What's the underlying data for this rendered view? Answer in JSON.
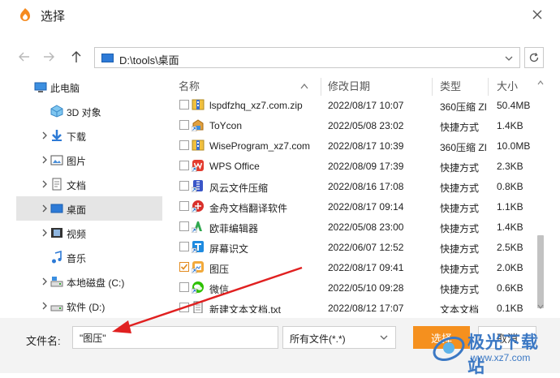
{
  "window": {
    "title": "选择"
  },
  "address": {
    "path": "D:\\tools\\桌面"
  },
  "sidebar": {
    "items": [
      {
        "label": "此电脑",
        "icon": "computer-icon",
        "expandable": false
      },
      {
        "label": "3D 对象",
        "icon": "3d-objects-icon",
        "expandable": false
      },
      {
        "label": "下载",
        "icon": "download-icon",
        "expandable": true
      },
      {
        "label": "图片",
        "icon": "pictures-icon",
        "expandable": true
      },
      {
        "label": "文档",
        "icon": "documents-icon",
        "expandable": true
      },
      {
        "label": "桌面",
        "icon": "desktop-icon",
        "expandable": true,
        "selected": true
      },
      {
        "label": "视频",
        "icon": "videos-icon",
        "expandable": true
      },
      {
        "label": "音乐",
        "icon": "music-icon",
        "expandable": false
      },
      {
        "label": "本地磁盘 (C:)",
        "icon": "local-disk-icon",
        "expandable": true
      },
      {
        "label": "软件 (D:)",
        "icon": "drive-icon",
        "expandable": true
      }
    ]
  },
  "columns": {
    "name": "名称",
    "date": "修改日期",
    "type": "类型",
    "size": "大小"
  },
  "files": [
    {
      "name": "lspdfzhq_xz7.com.zip",
      "date": "2022/08/17 10:07",
      "type": "360压缩 ZI",
      "size": "50.4MB",
      "icon": "zip-archive-icon",
      "checked": false
    },
    {
      "name": "ToYcon",
      "date": "2022/05/08 23:02",
      "type": "快捷方式",
      "size": "1.4KB",
      "icon": "toycon-app-icon",
      "checked": false
    },
    {
      "name": "WiseProgram_xz7.com",
      "date": "2022/08/17 10:39",
      "type": "360压缩 ZI",
      "size": "10.0MB",
      "icon": "zip-archive-icon",
      "checked": false
    },
    {
      "name": "WPS Office",
      "date": "2022/08/09 17:39",
      "type": "快捷方式",
      "size": "2.3KB",
      "icon": "wps-office-icon",
      "checked": false
    },
    {
      "name": "风云文件压缩",
      "date": "2022/08/16 17:08",
      "type": "快捷方式",
      "size": "0.8KB",
      "icon": "compress-app-icon",
      "checked": false
    },
    {
      "name": "金舟文档翻译软件",
      "date": "2022/08/17 09:14",
      "type": "快捷方式",
      "size": "1.1KB",
      "icon": "translate-app-icon",
      "checked": false
    },
    {
      "name": "欧菲编辑器",
      "date": "2022/05/08 23:00",
      "type": "快捷方式",
      "size": "1.4KB",
      "icon": "editor-app-icon",
      "checked": false
    },
    {
      "name": "屏幕识文",
      "date": "2022/06/07 12:52",
      "type": "快捷方式",
      "size": "2.5KB",
      "icon": "ocr-app-icon",
      "checked": false
    },
    {
      "name": "图压",
      "date": "2022/08/17 09:41",
      "type": "快捷方式",
      "size": "2.0KB",
      "icon": "image-compress-app-icon",
      "checked": true
    },
    {
      "name": "微信",
      "date": "2022/05/10 09:28",
      "type": "快捷方式",
      "size": "0.6KB",
      "icon": "wechat-icon",
      "checked": false
    },
    {
      "name": "新建文本文档.txt",
      "date": "2022/08/12 17:07",
      "type": "文本文档",
      "size": "0.1KB",
      "icon": "text-file-icon",
      "checked": false
    }
  ],
  "footer": {
    "filename_label": "文件名:",
    "filename_value": "\"图压\"",
    "filter": "所有文件(*.*)",
    "ok": "选择",
    "cancel": "取消"
  },
  "watermark": {
    "brand": "极光下载站",
    "url": "www.xz7.com"
  },
  "colors": {
    "accent": "#f5901e",
    "selected_bg": "#e5e5e5",
    "annotation_arrow": "#e02020",
    "watermark": "#3b78c4"
  }
}
